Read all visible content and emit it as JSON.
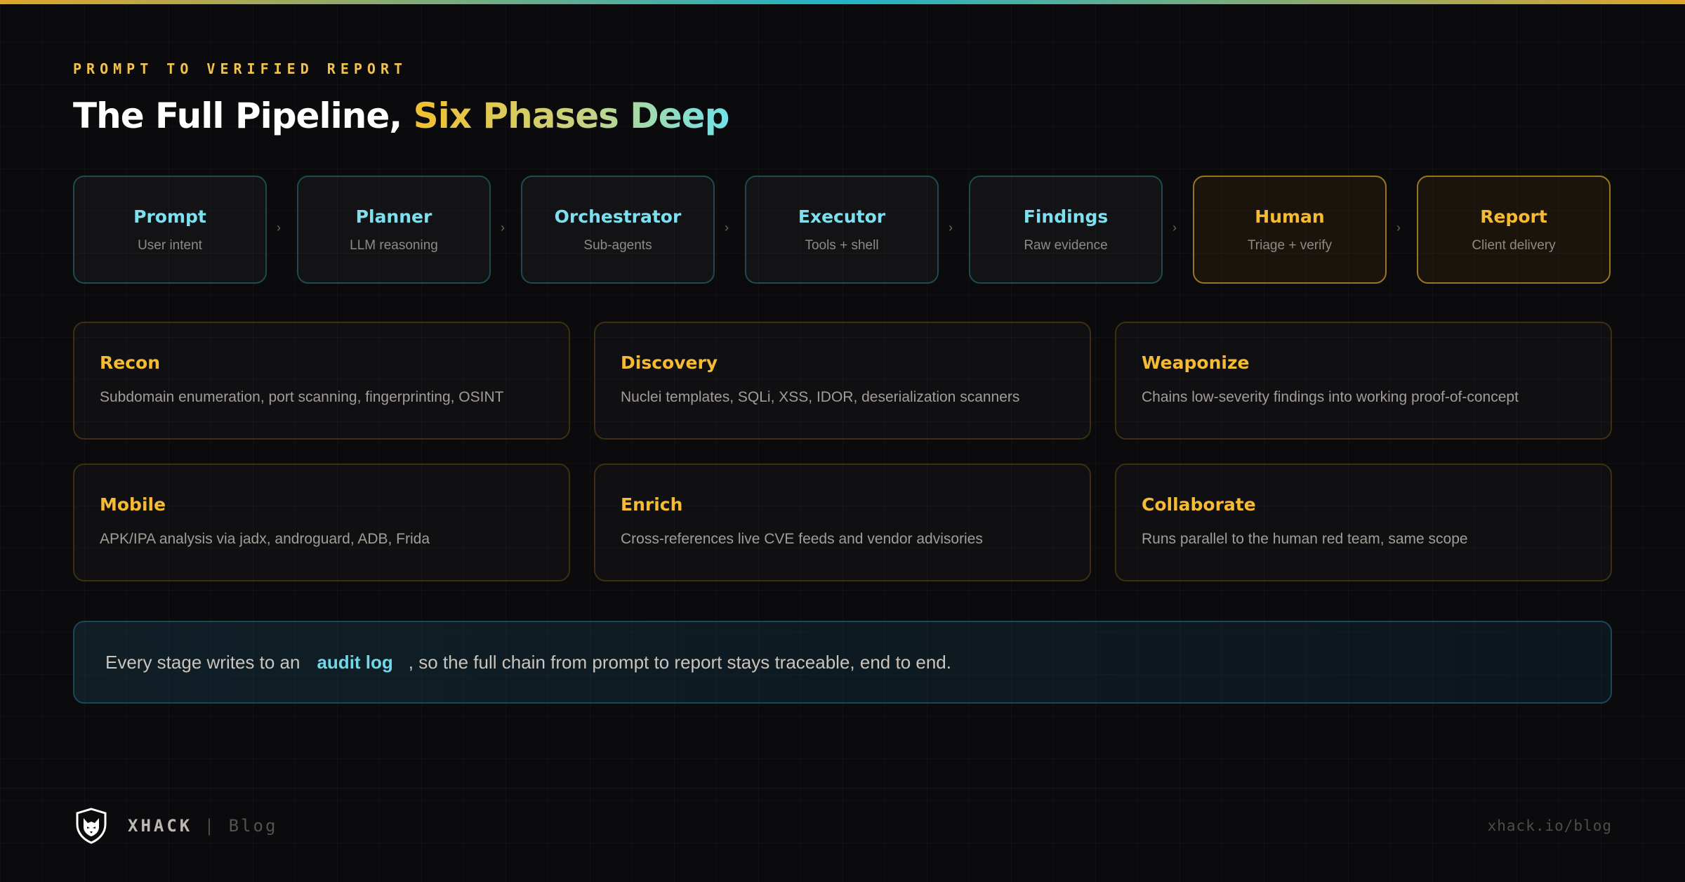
{
  "header": {
    "eyebrow": "PROMPT TO VERIFIED REPORT",
    "title_main": "The Full Pipeline, ",
    "title_highlight": "Six Phases Deep"
  },
  "flow": {
    "steps": [
      {
        "title": "Prompt",
        "subtitle": "User intent",
        "style": "teal"
      },
      {
        "title": "Planner",
        "subtitle": "LLM reasoning",
        "style": "teal"
      },
      {
        "title": "Orchestrator",
        "subtitle": "Sub-agents",
        "style": "teal"
      },
      {
        "title": "Executor",
        "subtitle": "Tools + shell",
        "style": "teal"
      },
      {
        "title": "Findings",
        "subtitle": "Raw evidence",
        "style": "teal"
      },
      {
        "title": "Human",
        "subtitle": "Triage + verify",
        "style": "gold"
      },
      {
        "title": "Report",
        "subtitle": "Client delivery",
        "style": "gold"
      }
    ],
    "arrow_glyph": "›"
  },
  "phases": [
    {
      "title": "Recon",
      "description": "Subdomain enumeration, port scanning, fingerprinting, OSINT"
    },
    {
      "title": "Discovery",
      "description": "Nuclei templates, SQLi, XSS, IDOR, deserialization scanners"
    },
    {
      "title": "Weaponize",
      "description": "Chains low-severity findings into working proof-of-concept"
    },
    {
      "title": "Mobile",
      "description": "APK/IPA analysis via jadx, androguard, ADB, Frida"
    },
    {
      "title": "Enrich",
      "description": "Cross-references live CVE feeds and vendor advisories"
    },
    {
      "title": "Collaborate",
      "description": "Runs parallel to the human red team, same scope"
    }
  ],
  "callout": {
    "before": "Every stage writes to an",
    "highlight": "audit log",
    "after": ", so the full chain from prompt to report stays traceable, end to end."
  },
  "footer": {
    "brand": "XHACK",
    "separator": "|",
    "section": "Blog",
    "url": "xhack.io/blog",
    "logo_icon": "wolf-shield-icon"
  },
  "colors": {
    "accent_gold": "#f5bb35",
    "accent_teal": "#7ee0ef",
    "background": "#0b0a0d"
  }
}
